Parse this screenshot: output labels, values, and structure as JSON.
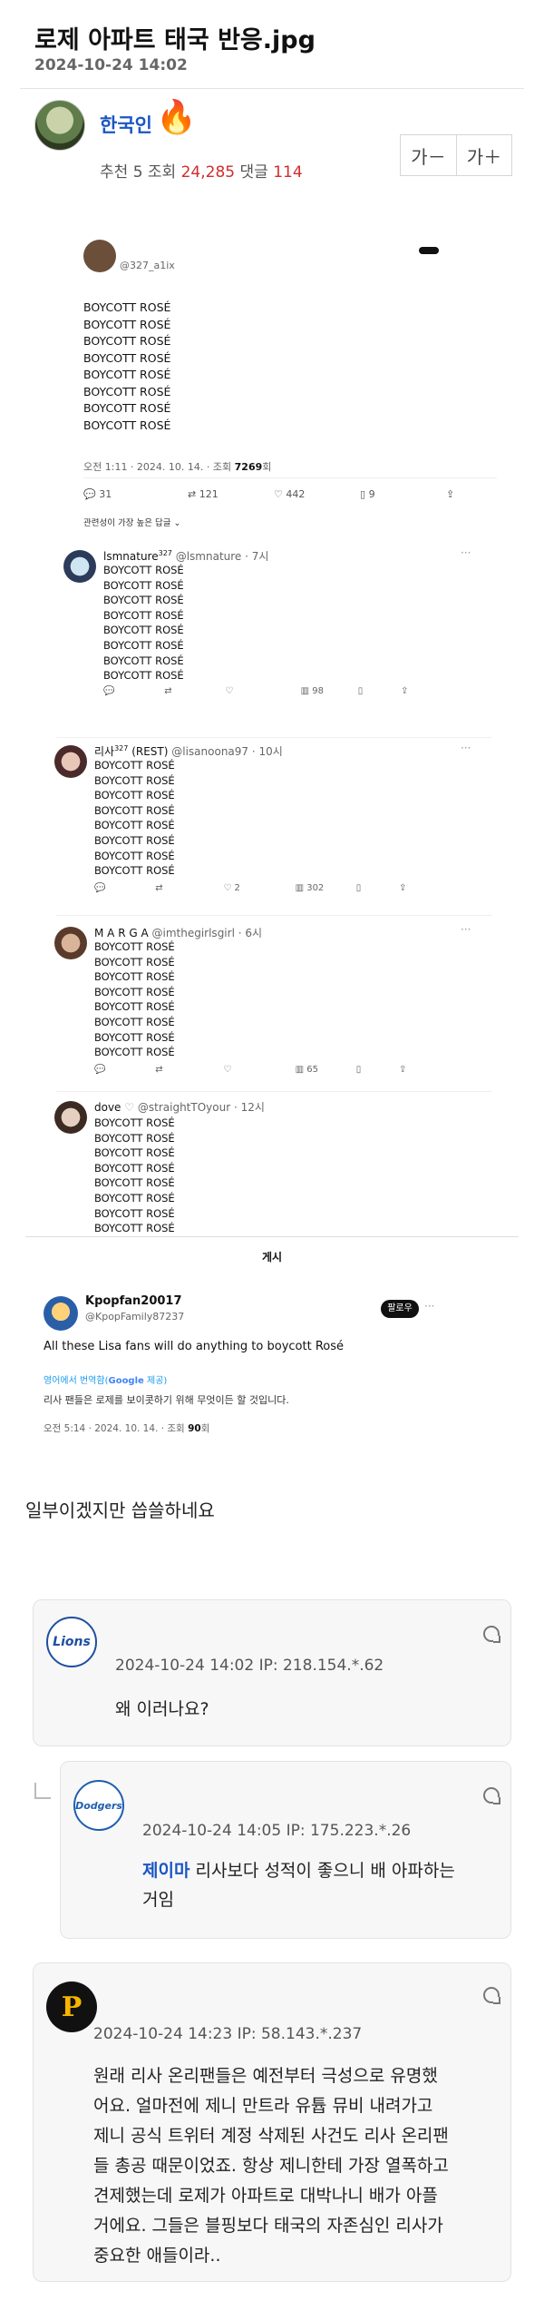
{
  "post": {
    "title": "로제 아파트 태국 반응.jpg",
    "date": "2024-10-24 14:02",
    "author": "한국인",
    "stats_label_rec": "추천",
    "rec_count": "5",
    "stats_label_views": "조회",
    "views": "24,285",
    "stats_label_comments": "댓글",
    "comments": "114",
    "font_smaller": "가－",
    "font_larger": "가＋",
    "body_text": "일부이겠지만 씁쓸하네요"
  },
  "tweet_main": {
    "handle": "@327_a1ix",
    "lines": [
      "BOYCOTT ROSÉ",
      "BOYCOTT ROSÉ",
      "BOYCOTT ROSÉ",
      "BOYCOTT ROSÉ",
      "BOYCOTT ROSÉ",
      "BOYCOTT ROSÉ",
      "BOYCOTT ROSÉ",
      "BOYCOTT ROSÉ"
    ],
    "meta_time": "오전 1:11 · 2024. 10. 14. · 조회",
    "meta_views": "7269",
    "meta_unit": "회",
    "reply_count": "31",
    "retweet_count": "121",
    "like_count": "442",
    "bookmark_count": "9",
    "sort_label": "관련성이 가장 높은 답글"
  },
  "replies": [
    {
      "name": "lsmnature",
      "sup": "327",
      "handle": "@lsmnature · 7시",
      "lines": [
        "BOYCOTT ROSÉ",
        "BOYCOTT ROSÉ",
        "BOYCOTT ROSÉ",
        "BOYCOTT ROSÉ",
        "BOYCOTT ROSÉ",
        "BOYCOTT ROSÉ",
        "BOYCOTT ROSÉ",
        "BOYCOTT ROSÉ"
      ],
      "views": "98",
      "likes": ""
    },
    {
      "name": "리사",
      "sup": "327",
      "name_suffix": "(REST)",
      "handle": "@lisanoona97 · 10시",
      "lines": [
        "BOYCOTT ROSÉ",
        "BOYCOTT ROSÉ",
        "BOYCOTT ROSÉ",
        "BOYCOTT ROSÉ",
        "BOYCOTT ROSÉ",
        "BOYCOTT ROSÉ",
        "BOYCOTT ROSÉ",
        "BOYCOTT ROSÉ"
      ],
      "views": "302",
      "likes": "2"
    },
    {
      "name": "M A R G A",
      "handle": "@imthegirlsgirl · 6시",
      "lines": [
        "BOYCOTT ROSÉ",
        "BOYCOTT ROSÉ",
        "BOYCOTT ROSÉ",
        "BOYCOTT ROSÉ",
        "BOYCOTT ROSÉ",
        "BOYCOTT ROSÉ",
        "BOYCOTT ROSÉ",
        "BOYCOTT ROSÉ"
      ],
      "views": "65",
      "likes": ""
    },
    {
      "name": "dove",
      "handle": "@straightTOyour · 12시",
      "lines": [
        "BOYCOTT ROSÉ",
        "BOYCOTT ROSÉ",
        "BOYCOTT ROSÉ",
        "BOYCOTT ROSÉ",
        "BOYCOTT ROSÉ",
        "BOYCOTT ROSÉ",
        "BOYCOTT ROSÉ",
        "BOYCOTT ROSÉ"
      ]
    }
  ],
  "quote": {
    "header": "게시",
    "name": "Kpopfan20017",
    "handle": "@KpopFamily87237",
    "follow": "팔로우",
    "text": "All these Lisa fans will do anything to boycott Rosé",
    "translate_prefix": "영어에서 번역함(",
    "translate_google": "Google",
    "translate_suffix": " 제공)",
    "text_ko": "리사 팬들은 로제를 보이콧하기 위해 무엇이든 할 것입니다.",
    "meta_time": "오전 5:14 · 2024. 10. 14. · 조회",
    "meta_views": "90",
    "meta_unit": "회"
  },
  "comments": [
    {
      "logo": "Lions",
      "meta": "2024-10-24 14:02   IP: 218.154.*.62",
      "text": "왜 이러나요?"
    },
    {
      "logo": "Dodgers",
      "meta": "2024-10-24 14:05   IP: 175.223.*.26",
      "mention": "제이마",
      "text": " 리사보다 성적이 좋으니 배 아파하는",
      "text2": "거임"
    },
    {
      "logo": "P",
      "meta": "2024-10-24 14:23   IP: 58.143.*.237",
      "lines": [
        "원래 리사 온리팬들은 예전부터 극성으로 유명했",
        "어요. 얼마전에 제니 만트라 유튭 뮤비 내려가고",
        "제니 공식 트위터 계정 삭제된 사건도 리사 온리팬",
        "들 총공 때문이었죠. 항상 제니한테 가장 열폭하고",
        "견제했는데 로제가 아파트로 대박나니 배가 아플",
        "거에요. 그들은 블핑보다 태국의 자존심인 리사가",
        "중요한 애들이라.."
      ]
    }
  ],
  "colors": {
    "accent": "#1a56c4",
    "red": "#d12d2d",
    "twitter_blue": "#1d9bf0"
  }
}
